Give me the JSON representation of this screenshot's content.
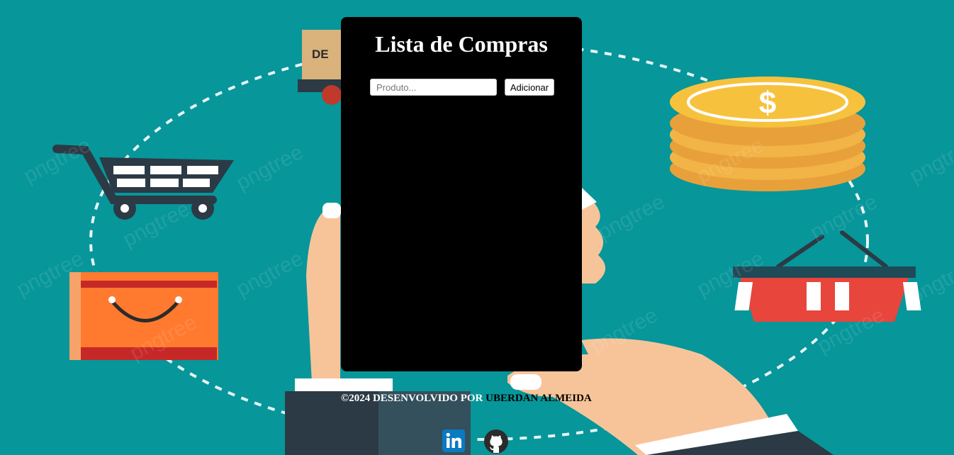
{
  "card": {
    "title": "Lista de Compras",
    "input_placeholder": "Produto...",
    "input_value": "",
    "add_label": "Adicionar",
    "items": []
  },
  "footer": {
    "prefix": "©2024 DESENVOLVIDO POR ",
    "author": "UBERDAN ALMEIDA"
  },
  "social": [
    {
      "name": "linkedin",
      "icon": "linkedin-icon"
    },
    {
      "name": "github",
      "icon": "github-icon"
    }
  ],
  "background": {
    "image": "shopping-illustration",
    "watermark": "pngtree",
    "box_label": "DE",
    "colors": {
      "teal": "#07969a",
      "coin": "#f2b447",
      "basket": "#e8453c",
      "bag": "#ff7a2f",
      "skin": "#f7c49a"
    }
  }
}
